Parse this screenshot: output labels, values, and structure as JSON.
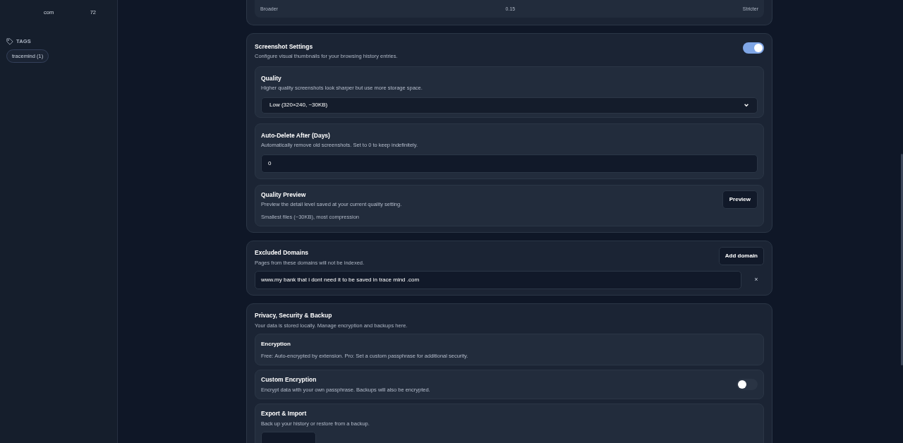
{
  "sidebar": {
    "domains": [
      {
        "name": "com",
        "count": "72"
      }
    ],
    "tags_heading": "TAGS",
    "tags": [
      "tracemind (1)"
    ]
  },
  "threshold": {
    "left": "Broader",
    "value": "0.15",
    "right": "Stricter"
  },
  "screenshot": {
    "title": "Screenshot Settings",
    "description": "Configure visual thumbnails for your browsing history entries.",
    "on": true,
    "quality": {
      "title": "Quality",
      "description": "Higher quality screenshots look sharper but use more storage space.",
      "value": "Low (320×240, ~30KB)"
    },
    "auto_delete": {
      "title": "Auto-Delete After (Days)",
      "description": "Automatically remove old screenshots. Set to 0 to keep indefinitely.",
      "value": "0"
    },
    "preview": {
      "title": "Quality Preview",
      "description": "Preview the detail level saved at your current quality setting.",
      "note": "Smallest files (~30KB), most compression",
      "button": "Preview"
    }
  },
  "excluded": {
    "title": "Excluded Domains",
    "description": "Pages from these domains will not be indexed.",
    "button": "Add domain",
    "domains": [
      {
        "value": "www.my bank that i dont need it to be saved in trace mind .com",
        "remove": "×"
      }
    ]
  },
  "privacy": {
    "title": "Privacy, Security & Backup",
    "description": "Your data is stored locally. Manage encryption and backups here.",
    "encryption": {
      "title": "Encryption",
      "description": "Free: Auto-encrypted by extension. Pro: Set a custom passphrase for additional security."
    },
    "custom": {
      "title": "Custom Encryption",
      "description": "Encrypt data with your own passphrase. Backups will also be encrypted.",
      "on": false
    },
    "export": {
      "title": "Export & Import",
      "description": "Back up your history or restore from a backup."
    }
  }
}
